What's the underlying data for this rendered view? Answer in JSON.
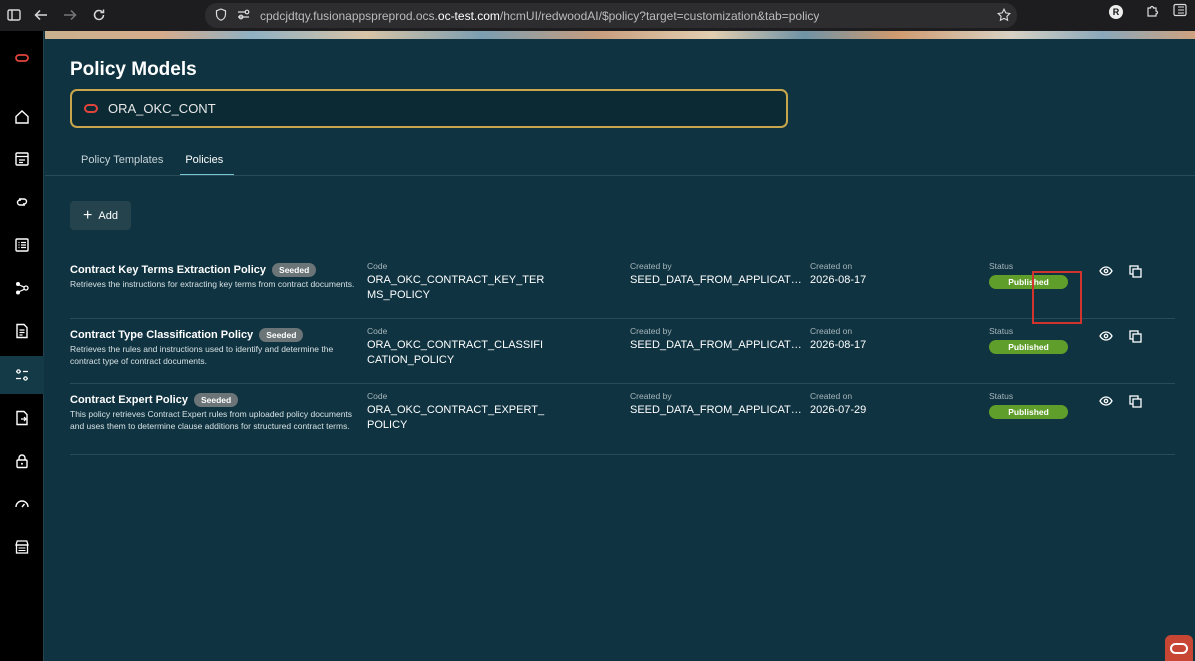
{
  "browser": {
    "url_prefix": "cpdcjdtqy.fusionappspreprod.ocs.",
    "url_host": "oc-test.com",
    "url_suffix": "/hcmUI/redwoodAI/$policy?target=customization&tab=policy",
    "profile_initial": "R"
  },
  "header": {
    "title": "Policy Models",
    "search_value": "ORA_OKC_CONT"
  },
  "tabs": [
    {
      "label": "Policy Templates",
      "active": false
    },
    {
      "label": "Policies",
      "active": true
    }
  ],
  "toolbar": {
    "add_label": "Add"
  },
  "columns": {
    "code": "Code",
    "created_by": "Created by",
    "created_on": "Created on",
    "status": "Status"
  },
  "policies": [
    {
      "name": "Contract Key Terms Extraction Policy",
      "badge": "Seeded",
      "description": "Retrieves the instructions for extracting key terms from contract documents.",
      "code": "ORA_OKC_CONTRACT_KEY_TERMS_POLICY",
      "created_by": "SEED_DATA_FROM_APPLICAT…",
      "created_on": "2026-08-17",
      "status": "Published"
    },
    {
      "name": "Contract Type Classification Policy",
      "badge": "Seeded",
      "description": "Retrieves the rules and instructions used to identify and determine the contract type of contract documents.",
      "code": "ORA_OKC_CONTRACT_CLASSIFICATION_POLICY",
      "created_by": "SEED_DATA_FROM_APPLICAT…",
      "created_on": "2026-08-17",
      "status": "Published"
    },
    {
      "name": "Contract Expert Policy",
      "badge": "Seeded",
      "description": "This policy retrieves Contract Expert rules from uploaded policy documents and uses them to determine clause additions for structured contract terms.",
      "code": "ORA_OKC_CONTRACT_EXPERT_POLICY",
      "created_by": "SEED_DATA_FROM_APPLICAT…",
      "created_on": "2026-07-29",
      "status": "Published"
    }
  ],
  "colors": {
    "background": "#0f3340",
    "accent": "#76c5d2",
    "published": "#5f9e2a",
    "highlight": "#d0342c",
    "oracle_red": "#c74634"
  }
}
